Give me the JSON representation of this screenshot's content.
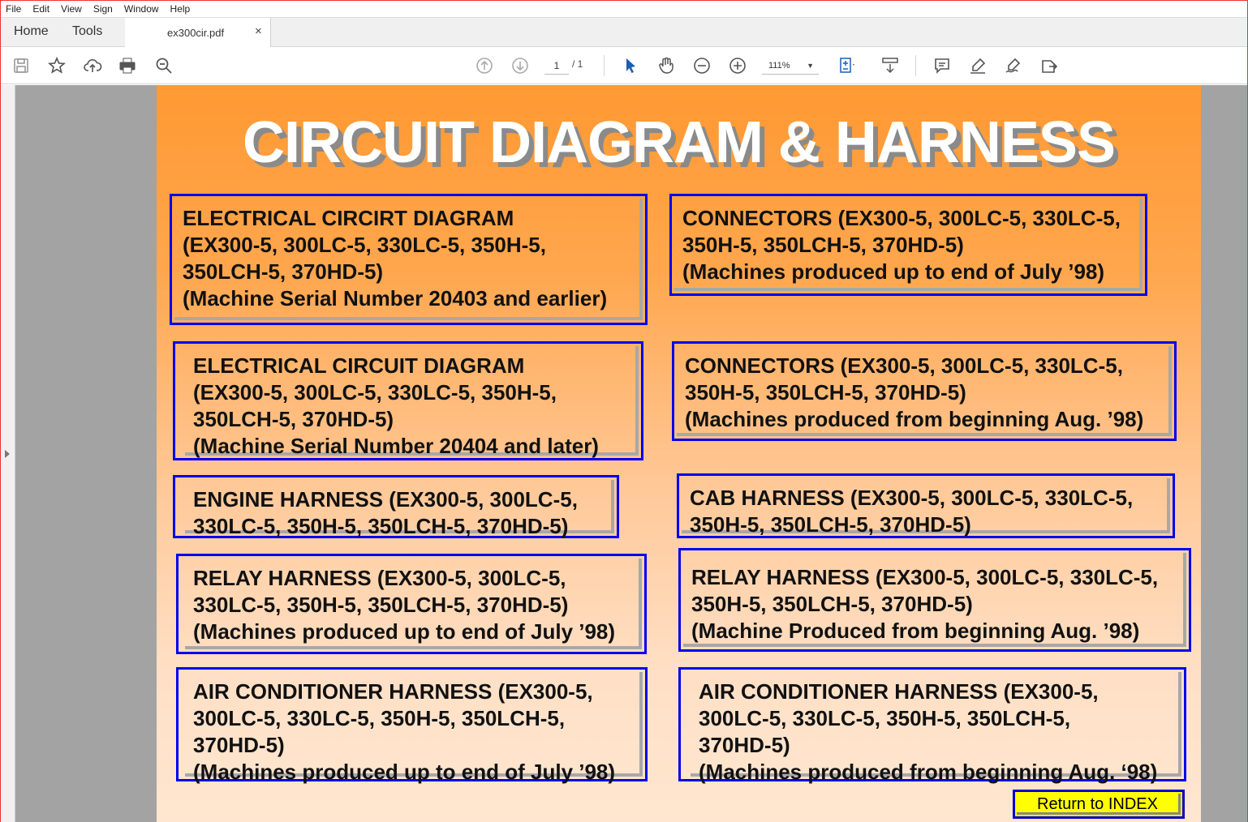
{
  "menu": [
    "File",
    "Edit",
    "View",
    "Sign",
    "Window",
    "Help"
  ],
  "tabs": {
    "home": "Home",
    "tools": "Tools",
    "document": "ex300cir.pdf",
    "close": "×"
  },
  "toolbar": {
    "page_current": "1",
    "page_total": "/ 1",
    "zoom": "111%",
    "icons": [
      "save-icon",
      "bookmark-star-icon",
      "upload-icon",
      "print-icon",
      "zoom-search-icon",
      "prev-page-icon",
      "next-page-icon",
      "select-arrow-icon",
      "hand-icon",
      "zoom-out-icon",
      "zoom-in-icon",
      "fit-page-icon",
      "scroll-mode-icon",
      "comment-icon",
      "highlight-icon",
      "sign-icon",
      "share-icon"
    ]
  },
  "document": {
    "title": "CIRCUIT DIAGRAM & HARNESS",
    "boxes": [
      {
        "text": "ELECTRICAL CIRCIRT DIAGRAM\n(EX300-5, 300LC-5, 330LC-5, 350H-5,\n350LCH-5, 370HD-5)\n(Machine Serial Number 20403 and earlier)"
      },
      {
        "text": "CONNECTORS (EX300-5, 300LC-5, 330LC-5,\n350H-5, 350LCH-5, 370HD-5)\n(Machines produced up to end of July ’98)"
      },
      {
        "text": "ELECTRICAL CIRCUIT DIAGRAM\n (EX300-5, 300LC-5, 330LC-5, 350H-5,\n350LCH-5, 370HD-5)\n(Machine Serial Number 20404 and later)"
      },
      {
        "text": "CONNECTORS (EX300-5, 300LC-5, 330LC-5,\n350H-5, 350LCH-5, 370HD-5)\n(Machines produced from beginning Aug. ’98)"
      },
      {
        "text": "ENGINE HARNESS (EX300-5, 300LC-5,\n330LC-5, 350H-5, 350LCH-5, 370HD-5)"
      },
      {
        "text": "CAB HARNESS (EX300-5, 300LC-5, 330LC-5,\n350H-5, 350LCH-5, 370HD-5)"
      },
      {
        "text": "RELAY HARNESS (EX300-5, 300LC-5,\n330LC-5, 350H-5, 350LCH-5, 370HD-5)\n(Machines produced up to end of July ’98)"
      },
      {
        "text": "RELAY HARNESS (EX300-5, 300LC-5, 330LC-5,\n350H-5, 350LCH-5, 370HD-5)\n(Machine Produced from beginning Aug. ’98)"
      },
      {
        "text": "AIR CONDITIONER HARNESS (EX300-5,\n300LC-5, 330LC-5, 350H-5, 350LCH-5,\n370HD-5)\n(Machines produced up to end of July ’98)"
      },
      {
        "text": "AIR CONDITIONER HARNESS (EX300-5,\n300LC-5, 330LC-5, 350H-5, 350LCH-5,\n370HD-5)\n(Machines produced from beginning Aug. ‘98)"
      }
    ],
    "return_button": "Return to INDEX"
  },
  "colors": {
    "box_border": "#0000ee",
    "page_top": "#ff9933",
    "page_bottom": "#ffe6d0",
    "button_bg": "#ffff00"
  }
}
